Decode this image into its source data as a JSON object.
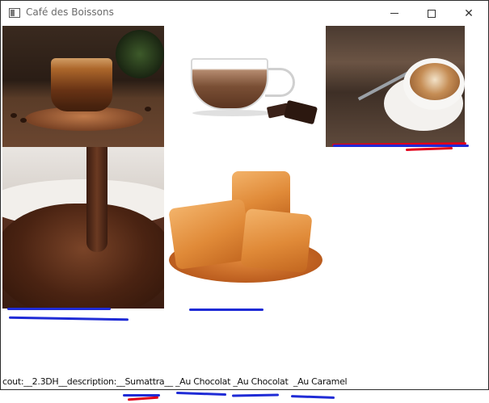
{
  "window": {
    "title": "Café des Boissons",
    "icon": "app-window-icon",
    "controls": {
      "minimize": "minimize-icon",
      "maximize": "maximize-icon",
      "close": "close-icon",
      "close_glyph": "✕"
    }
  },
  "gallery": {
    "items": [
      {
        "name": "espresso-image"
      },
      {
        "name": "hot-chocolate-image"
      },
      {
        "name": "cappuccino-image"
      },
      {
        "name": "chocolate-pour-image"
      },
      {
        "name": "caramel-image"
      }
    ]
  },
  "status": {
    "text": "cout:__2.3DH__description:__Sumattra__ _Au Chocolat _Au Chocolat  _Au Caramel"
  },
  "colors": {
    "annotation_red": "#e2001a",
    "annotation_blue": "#1f2bd6"
  }
}
